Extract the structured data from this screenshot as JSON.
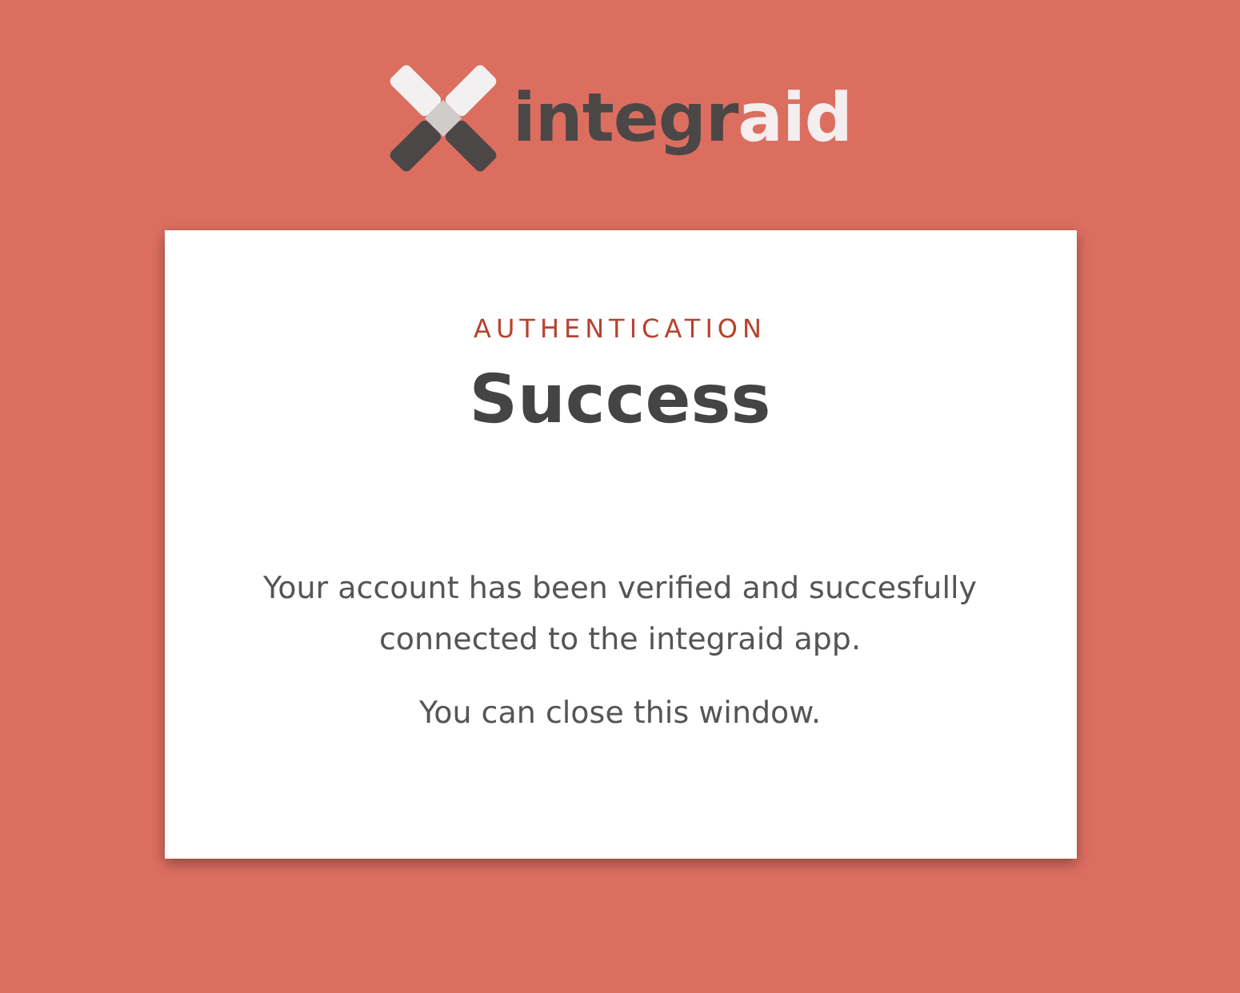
{
  "logo": {
    "text_dark": "integr",
    "text_light": "aid"
  },
  "card": {
    "eyebrow": "AUTHENTICATION",
    "title": "Success",
    "paragraphs": [
      "Your account has been verified and succesfully connected to the integraid app.",
      "You can close this window."
    ]
  }
}
